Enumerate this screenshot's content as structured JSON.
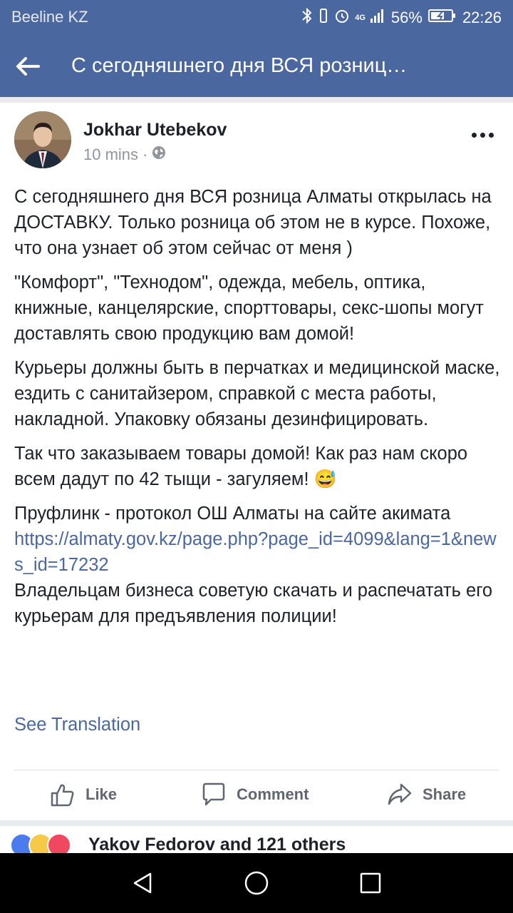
{
  "status_bar": {
    "carrier": "Beeline KZ",
    "network": "4G",
    "battery": "56%",
    "time": "22:26",
    "icons": [
      "bluetooth-icon",
      "alarm-icon",
      "signal-icon",
      "battery-icon"
    ]
  },
  "nav": {
    "title": "С сегодняшнего дня ВСЯ розниц…",
    "back_icon": "arrow-left-icon"
  },
  "post": {
    "author": "Jokhar Utebekov",
    "time": "10 mins",
    "separator": "·",
    "privacy_icon": "globe-icon",
    "paragraphs": [
      "С сегодняшнего дня ВСЯ розница Алматы открылась на ДОСТАВКУ. Только розница об этом не в курсе. Похоже, что она узнает об этом сейчас от меня )",
      "\"Комфорт\", \"Технодом\", одежда, мебель, оптика, книжные, канцелярские, спорттовары, секс-шопы могут доставлять свою продукцию вам домой!",
      "Курьеры должны быть в перчатках и медицинской маске, ездить с санитайзером, справкой с места работы, накладной. Упаковку обязаны дезинфицировать.",
      "Так что заказываем товары домой! Как раз нам скоро всем дадут по 42 тыщи - загуляем!"
    ],
    "emoji": "😅",
    "proof_text": "Пруфлинк - протокол ОШ Алматы на сайте акимата",
    "link": "https://almaty.gov.kz/page.php?page_id=4099&lang=1&news_id=17232",
    "closing": "Владельцам бизнеса советую скачать и распечатать его курьерам для предъявления полиции!",
    "see_translation": "See Translation"
  },
  "actions": {
    "like": "Like",
    "comment": "Comment",
    "share": "Share"
  },
  "reactions": {
    "text": "Yakov Fedorov and 121 others",
    "icons": [
      "like-reaction-icon",
      "haha-reaction-icon",
      "love-reaction-icon"
    ]
  },
  "colors": {
    "brand": "#4b67a0",
    "link": "#4b67a0",
    "text": "#1d2129",
    "muted": "#90949c"
  }
}
